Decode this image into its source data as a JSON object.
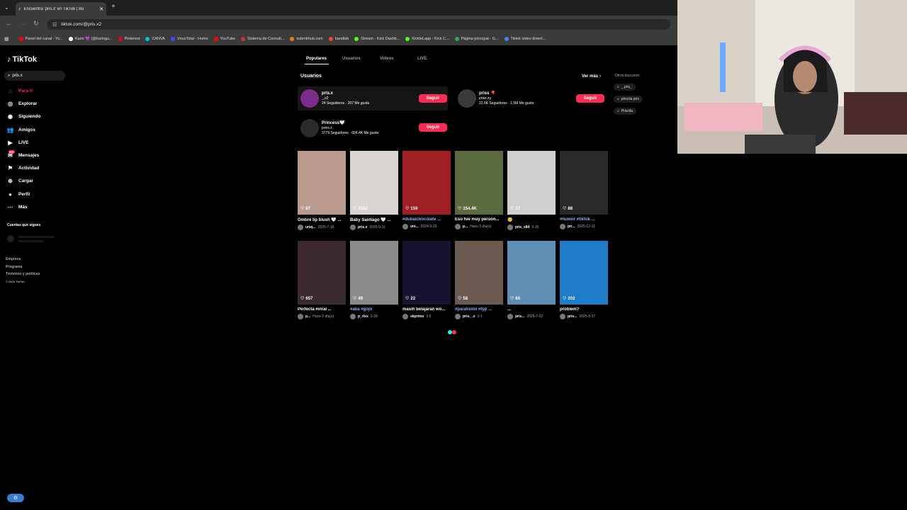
{
  "browser": {
    "tab_title": "Encuentra 'pris.x' en TikTok | Bu",
    "new_tab": "+",
    "url": "tiktok.com/@pris.x2",
    "bookmarks": [
      {
        "label": "Panel del canal - Yo...",
        "color": "#ff0000"
      },
      {
        "label": "Karin 💜 (@karingu...",
        "color": "#ffffff"
      },
      {
        "label": "Pinterest",
        "color": "#e60023"
      },
      {
        "label": "CANVA",
        "color": "#00c4cc"
      },
      {
        "label": "VirusTotal - Home",
        "color": "#394eff"
      },
      {
        "label": "YouTube",
        "color": "#ff0000"
      },
      {
        "label": "Sistema de Consult...",
        "color": "#c0392b"
      },
      {
        "label": "submithub.com",
        "color": "#e67e22"
      },
      {
        "label": "bandlab",
        "color": "#f44336"
      },
      {
        "label": "Stream - Kick Dashb...",
        "color": "#53fc18"
      },
      {
        "label": "KickleLapp - Kick C...",
        "color": "#53fc18"
      },
      {
        "label": "Página principal - G...",
        "color": "#34a853"
      },
      {
        "label": "Tiktok video downl...",
        "color": "#4285f4"
      }
    ]
  },
  "sidebar": {
    "logo": "TikTok",
    "search_value": "pris.x",
    "nav": [
      "Para ti",
      "Explorar",
      "Siguiendo",
      "Amigos",
      "LIVE",
      "Mensajes",
      "Actividad",
      "Cargar",
      "Perfil",
      "Más"
    ],
    "messages_badge": "99+",
    "following_title": "Cuentas que sigues",
    "footer": [
      "Empresa",
      "Programa",
      "Términos y políticas",
      "© 2026 TikTok"
    ]
  },
  "search_tabs": [
    "Populares",
    "Usuarios",
    "Videos",
    "LIVE"
  ],
  "users_section": {
    "title": "Usuarios",
    "see_more": "Ver más",
    "follow_label": "Seguir",
    "users": [
      {
        "name": "pris.x",
        "handle": "_.x2",
        "followers": "24 Seguidores",
        "likes": "207 Me gusta"
      },
      {
        "name": "priss 🎈",
        "handle": "priss.xy",
        "followers": "22.6K Seguidores",
        "likes": "1.5M Me gusta"
      },
      {
        "name": "Princess🤍",
        "handle": "prins.x",
        "followers": "3779 Seguidores",
        "likes": "604.4K Me gusta"
      }
    ]
  },
  "others_searched": {
    "title": "Otros buscaron",
    "items": [
      "_.pris_",
      "priscila pris",
      "Priscila"
    ]
  },
  "videos": [
    {
      "likes": "87",
      "title": "Ombré lip blush 🤍 ...",
      "author": "uniq...",
      "date": "2025-7-16",
      "bg": "#b99a8c"
    },
    {
      "likes": "2552",
      "title": "Baby Santiago 🤍 ...",
      "author": "pris.x",
      "date": "2025-9-11",
      "bg": "#d7d4d2"
    },
    {
      "likes": "159",
      "title": "#dubaichocolate ...",
      "author": "uni...",
      "date": "2024-9-29",
      "bg": "#9e1e24"
    },
    {
      "likes": "154.4K",
      "title": "Eso fue muy person...",
      "author": "p...",
      "date": "Hace 3 día(s)",
      "bg": "#5b6a3f"
    },
    {
      "likes": "17",
      "title": "😊",
      "author": "pris_x84",
      "date": "3-15",
      "bg": "#cfcfcf"
    },
    {
      "likes": "88",
      "title": "#humor #tiktok ...",
      "author": "pri...",
      "date": "2025-12-11",
      "bg": "#2a2a2a"
    },
    {
      "likes": "657",
      "title": "Perfecta #viral ...",
      "author": "p...",
      "date": "Hace 2 día(s)",
      "bg": "#3b2a30"
    },
    {
      "likes": "49",
      "title": "#aba #gojo",
      "author": "p_risx",
      "date": "2-28",
      "bg": "#8b8b8b"
    },
    {
      "likes": "22",
      "title": "masih belajaran wo...",
      "author": "skprimx",
      "date": "3-5",
      "bg": "#151330"
    },
    {
      "likes": "58",
      "title": "#paratiiiiiiii #fyp ...",
      "author": "pris._.x",
      "date": "3-1",
      "bg": "#6a5a50"
    },
    {
      "likes": "66",
      "title": "...",
      "author": "pris...",
      "date": "2025-7-22",
      "bg": "#5f8fb5"
    },
    {
      "likes": "202",
      "title": "problem?",
      "author": "pris...",
      "date": "2025-3-17",
      "bg": "#1e7cc8"
    }
  ],
  "colors": {
    "accent": "#fe2c55",
    "hashtag": "#8ab4f8"
  }
}
